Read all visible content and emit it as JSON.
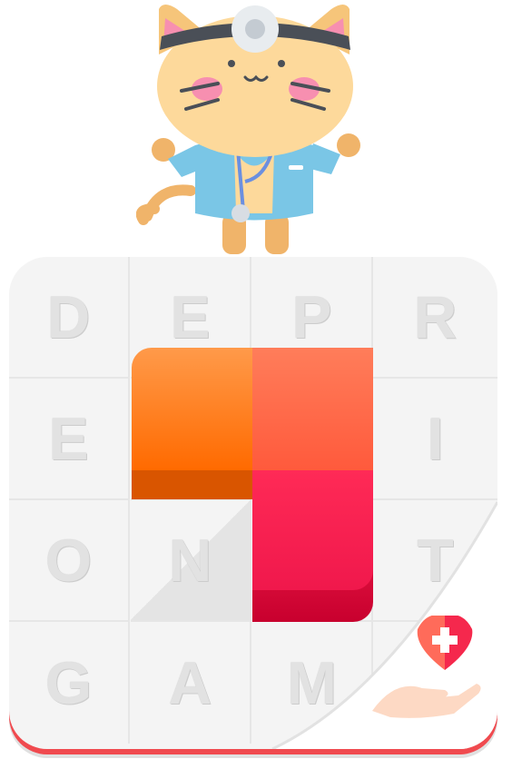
{
  "board": {
    "letters": [
      [
        "D",
        "E",
        "P",
        "R"
      ],
      [
        "E",
        "",
        "",
        "I"
      ],
      [
        "O",
        "N",
        "",
        "T"
      ],
      [
        "G",
        "A",
        "M",
        ""
      ]
    ]
  },
  "colors": {
    "orange_top": "#ff9a4a",
    "orange_bottom": "#ff6a00",
    "salmon": "#ff7a50",
    "red": "#f51f52",
    "base_red": "#f04a4f"
  },
  "icons": [
    "doctor-cat-mascot",
    "heart-hand-icon"
  ]
}
